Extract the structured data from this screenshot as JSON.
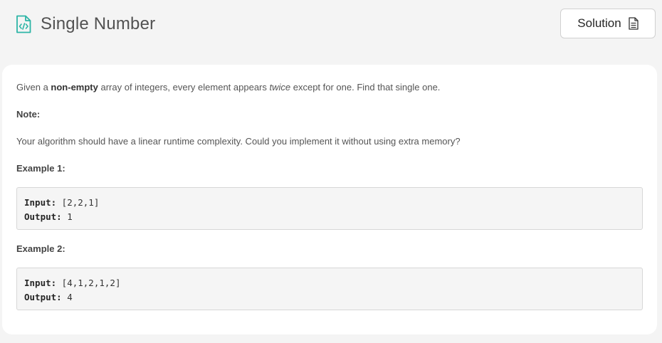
{
  "header": {
    "title": "Single Number",
    "title_icon": "code-file-icon",
    "solution_label": "Solution",
    "solution_icon": "document-icon"
  },
  "problem": {
    "intro_prefix": "Given a ",
    "intro_bold": "non-empty",
    "intro_mid": " array of integers, every element appears ",
    "intro_italic": "twice",
    "intro_suffix": " except for one. Find that single one.",
    "note_label": "Note:",
    "note_text": "Your algorithm should have a linear runtime complexity. Could you implement it without using extra memory?",
    "examples": [
      {
        "label": "Example 1:",
        "input_key": "Input:",
        "input_value": " [2,2,1]",
        "output_key": "Output:",
        "output_value": " 1"
      },
      {
        "label": "Example 2:",
        "input_key": "Input:",
        "input_value": " [4,1,2,1,2]",
        "output_key": "Output:",
        "output_value": " 4"
      }
    ]
  },
  "colors": {
    "accent": "#2db5a6",
    "background": "#f4f4f4",
    "card": "#ffffff"
  }
}
